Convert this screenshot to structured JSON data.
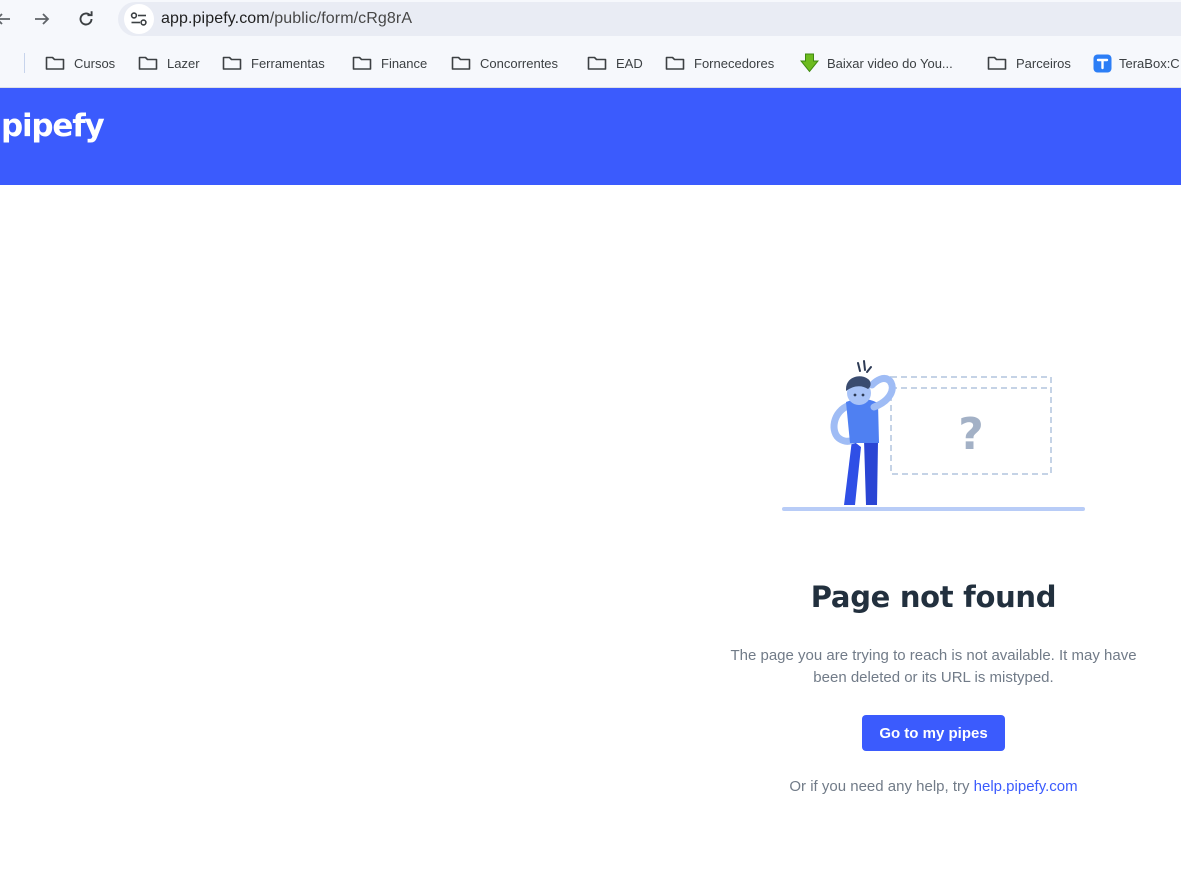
{
  "browser": {
    "url_domain": "app.pipefy.com",
    "url_path": "/public/form/cRg8rA",
    "icons": [
      "back-arrow-icon",
      "forward-arrow-icon",
      "reload-icon",
      "site-info-icon",
      "apps-grid-icon"
    ]
  },
  "bookmarks": [
    {
      "label": "Cursos",
      "icon": "folder-icon"
    },
    {
      "label": "Lazer",
      "icon": "folder-icon"
    },
    {
      "label": "Ferramentas",
      "icon": "folder-icon"
    },
    {
      "label": "Finance",
      "icon": "folder-icon"
    },
    {
      "label": "Concorrentes",
      "icon": "folder-icon"
    },
    {
      "label": "EAD",
      "icon": "folder-icon"
    },
    {
      "label": "Fornecedores",
      "icon": "folder-icon"
    },
    {
      "label": "Baixar video do You...",
      "icon": "download-arrow-icon"
    },
    {
      "label": "Parceiros",
      "icon": "folder-icon"
    },
    {
      "label": "TeraBox:C",
      "icon": "terabox-icon"
    }
  ],
  "header": {
    "logo_text": "pipefy",
    "background": "#3b5bfd"
  },
  "main": {
    "illustration_symbol": "?",
    "title": "Page not found",
    "description_line1": "The page you are trying to reach is not available. It may have",
    "description_line2": "been deleted or its URL is mistyped.",
    "button_label": "Go to my pipes",
    "help_prefix": "Or if you need any help, try ",
    "help_link": "help.pipefy.com"
  },
  "colors": {
    "accent": "#3b5bfd",
    "title": "#22303e",
    "muted_text": "#717b88"
  }
}
